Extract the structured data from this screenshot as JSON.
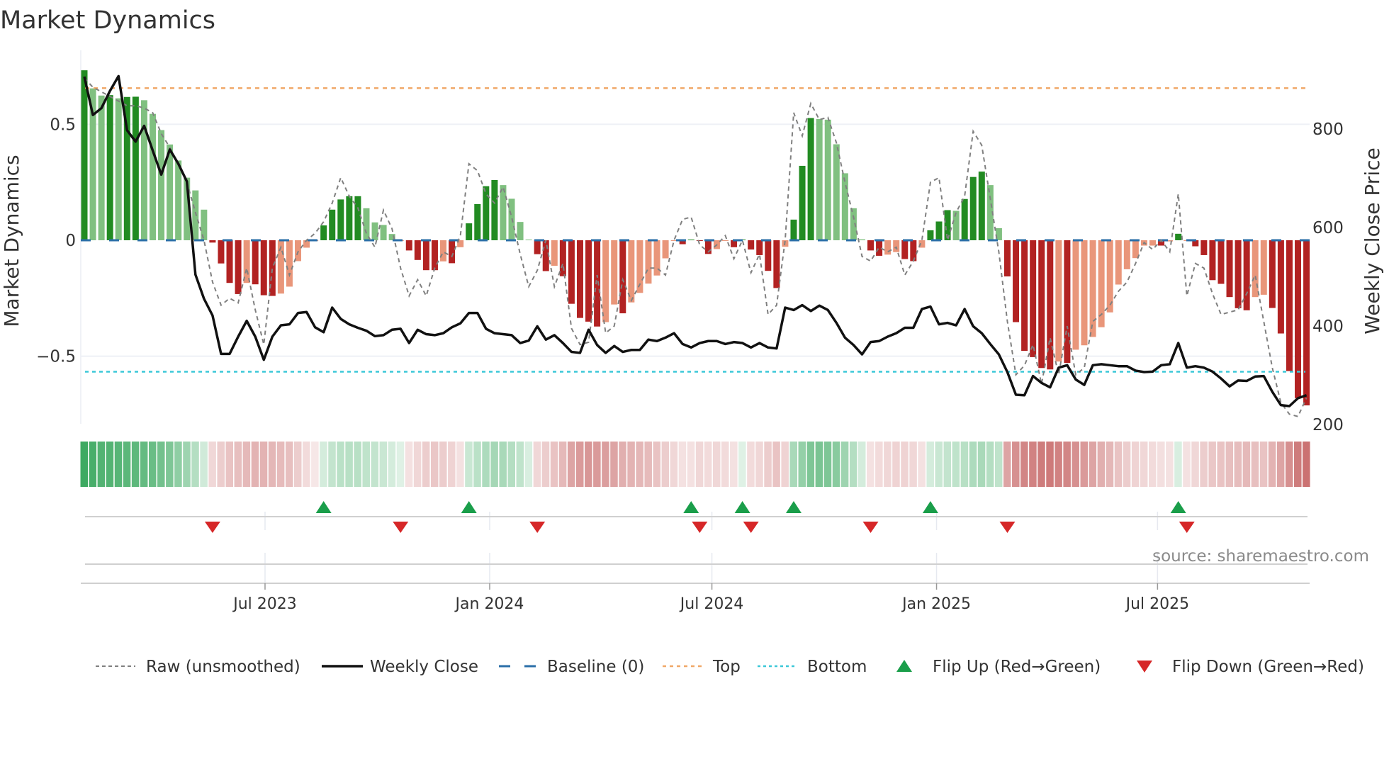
{
  "chart_data": {
    "type": "bar",
    "title": "Market Dynamics",
    "ylabel": "Market Dynamics",
    "y2label": "Weekly Close Price",
    "ylim": [
      -0.79,
      0.79
    ],
    "y2lim": [
      200,
      944
    ],
    "yticks": [
      {
        "v": 0.5,
        "label": "0.5"
      },
      {
        "v": 0,
        "label": "0"
      },
      {
        "v": -0.5,
        "label": "−0.5"
      }
    ],
    "y2ticks": [
      {
        "v": 800,
        "label": "800"
      },
      {
        "v": 600,
        "label": "600"
      },
      {
        "v": 400,
        "label": "400"
      },
      {
        "v": 200,
        "label": "200"
      }
    ],
    "start_date": "2023-02-03",
    "frequency": "weekly",
    "xticks": [
      {
        "date": "2023-07-01",
        "label": "Jul 2023"
      },
      {
        "date": "2024-01-01",
        "label": "Jan 2024"
      },
      {
        "date": "2024-07-01",
        "label": "Jul 2024"
      },
      {
        "date": "2025-01-01",
        "label": "Jan 2025"
      },
      {
        "date": "2025-07-01",
        "label": "Jul 2025"
      }
    ],
    "top": 0.656,
    "bottom": -0.567,
    "baseline": 0,
    "values": [
      0.733,
      0.655,
      0.624,
      0.626,
      0.612,
      0.618,
      0.619,
      0.604,
      0.545,
      0.475,
      0.413,
      0.344,
      0.27,
      0.215,
      0.132,
      -0.01,
      -0.1,
      -0.184,
      -0.232,
      -0.184,
      -0.19,
      -0.237,
      -0.24,
      -0.23,
      -0.2,
      -0.09,
      -0.032,
      -0.003,
      0.064,
      0.132,
      0.176,
      0.19,
      0.19,
      0.138,
      0.077,
      0.066,
      0.027,
      -0.003,
      -0.044,
      -0.085,
      -0.129,
      -0.129,
      -0.091,
      -0.099,
      -0.03,
      0.073,
      0.156,
      0.233,
      0.26,
      0.238,
      0.179,
      0.079,
      0.003,
      -0.06,
      -0.133,
      -0.11,
      -0.155,
      -0.274,
      -0.335,
      -0.351,
      -0.372,
      -0.353,
      -0.277,
      -0.315,
      -0.268,
      -0.227,
      -0.187,
      -0.152,
      -0.078,
      -0.003,
      -0.017,
      0.003,
      -0.003,
      -0.059,
      -0.038,
      -0.003,
      -0.03,
      0.003,
      -0.04,
      -0.064,
      -0.132,
      -0.206,
      -0.028,
      0.089,
      0.321,
      0.527,
      0.523,
      0.52,
      0.414,
      0.289,
      0.138,
      0.004,
      -0.044,
      -0.067,
      -0.062,
      -0.051,
      -0.081,
      -0.09,
      -0.032,
      0.043,
      0.081,
      0.13,
      0.127,
      0.178,
      0.273,
      0.296,
      0.238,
      0.052,
      -0.156,
      -0.353,
      -0.477,
      -0.504,
      -0.551,
      -0.557,
      -0.523,
      -0.529,
      -0.472,
      -0.453,
      -0.417,
      -0.375,
      -0.311,
      -0.191,
      -0.125,
      -0.077,
      -0.023,
      -0.023,
      -0.023,
      -0.005,
      0.028,
      -0.003,
      -0.026,
      -0.064,
      -0.172,
      -0.188,
      -0.245,
      -0.293,
      -0.302,
      -0.245,
      -0.235,
      -0.292,
      -0.402,
      -0.564,
      -0.681,
      -0.712
    ],
    "strong": [
      1,
      0,
      0,
      1,
      0,
      1,
      1,
      0,
      0,
      0,
      0,
      0,
      0,
      0,
      0,
      1,
      1,
      1,
      1,
      0,
      1,
      1,
      1,
      0,
      0,
      0,
      0,
      0,
      1,
      1,
      1,
      1,
      1,
      0,
      0,
      0,
      0,
      0,
      1,
      1,
      1,
      1,
      0,
      1,
      0,
      1,
      1,
      1,
      1,
      0,
      0,
      0,
      0,
      1,
      1,
      0,
      1,
      1,
      1,
      1,
      1,
      0,
      0,
      1,
      0,
      0,
      0,
      0,
      0,
      0,
      1,
      1,
      1,
      1,
      0,
      0,
      1,
      1,
      1,
      1,
      1,
      1,
      0,
      1,
      1,
      1,
      0,
      0,
      0,
      0,
      0,
      0,
      1,
      1,
      0,
      0,
      1,
      1,
      0,
      1,
      1,
      1,
      0,
      1,
      1,
      1,
      0,
      0,
      1,
      1,
      1,
      1,
      1,
      1,
      0,
      1,
      0,
      0,
      0,
      0,
      0,
      0,
      0,
      0,
      0,
      0,
      1,
      0,
      1,
      0,
      1,
      1,
      1,
      1,
      1,
      1,
      1,
      0,
      0,
      1,
      1,
      1,
      1,
      1
    ],
    "raw": [
      0.7,
      0.66,
      0.64,
      0.62,
      0.6,
      0.58,
      0.58,
      0.57,
      0.55,
      0.46,
      0.4,
      0.33,
      0.25,
      0.12,
      0.0,
      -0.18,
      -0.28,
      -0.25,
      -0.27,
      -0.12,
      -0.3,
      -0.45,
      -0.12,
      -0.03,
      -0.15,
      -0.05,
      0.0,
      0.03,
      0.08,
      0.16,
      0.27,
      0.19,
      0.14,
      0.03,
      -0.03,
      0.13,
      0.05,
      -0.12,
      -0.24,
      -0.17,
      -0.24,
      -0.12,
      -0.05,
      -0.07,
      0.02,
      0.33,
      0.3,
      0.2,
      0.16,
      0.23,
      0.1,
      -0.06,
      -0.2,
      -0.13,
      0.0,
      -0.2,
      -0.1,
      -0.38,
      -0.45,
      -0.44,
      -0.15,
      -0.4,
      -0.37,
      -0.17,
      -0.26,
      -0.19,
      -0.12,
      -0.12,
      -0.15,
      0.0,
      0.09,
      0.1,
      -0.02,
      -0.05,
      -0.02,
      0.02,
      -0.08,
      0.0,
      -0.14,
      -0.06,
      -0.32,
      -0.28,
      0.0,
      0.55,
      0.45,
      0.59,
      0.52,
      0.53,
      0.42,
      0.25,
      0.1,
      -0.07,
      -0.09,
      -0.03,
      -0.05,
      -0.03,
      -0.15,
      -0.09,
      0.0,
      0.25,
      0.27,
      0.0,
      0.12,
      0.19,
      0.47,
      0.41,
      0.18,
      -0.05,
      -0.35,
      -0.58,
      -0.54,
      -0.45,
      -0.62,
      -0.42,
      -0.58,
      -0.37,
      -0.58,
      -0.55,
      -0.35,
      -0.32,
      -0.28,
      -0.22,
      -0.18,
      -0.1,
      -0.01,
      -0.04,
      0.0,
      -0.05,
      0.2,
      -0.24,
      -0.1,
      -0.12,
      -0.23,
      -0.32,
      -0.31,
      -0.3,
      -0.23,
      -0.15,
      -0.35,
      -0.55,
      -0.7,
      -0.75,
      -0.76,
      -0.68
    ],
    "close": [
      905,
      827,
      841,
      876,
      906,
      796,
      773,
      805,
      755,
      706,
      757,
      728,
      692,
      503,
      454,
      420,
      342,
      342,
      377,
      409,
      377,
      330,
      377,
      400,
      402,
      425,
      427,
      396,
      386,
      436,
      413,
      402,
      395,
      389,
      378,
      380,
      391,
      393,
      364,
      391,
      382,
      380,
      384,
      396,
      404,
      425,
      425,
      393,
      384,
      382,
      380,
      364,
      369,
      398,
      371,
      380,
      364,
      346,
      344,
      391,
      360,
      344,
      358,
      346,
      350,
      350,
      371,
      368,
      375,
      384,
      362,
      355,
      364,
      368,
      368,
      362,
      366,
      364,
      355,
      364,
      355,
      353,
      436,
      431,
      441,
      429,
      440,
      431,
      405,
      375,
      360,
      341,
      366,
      368,
      377,
      384,
      395,
      395,
      433,
      438,
      402,
      405,
      400,
      433,
      398,
      384,
      362,
      341,
      305,
      259,
      258,
      297,
      283,
      274,
      314,
      319,
      290,
      279,
      319,
      321,
      319,
      317,
      317,
      308,
      305,
      306,
      319,
      321,
      364,
      314,
      317,
      314,
      306,
      292,
      276,
      288,
      287,
      296,
      297,
      265,
      238,
      236,
      252,
      258
    ],
    "strip": [
      0.9,
      0.85,
      0.8,
      0.8,
      0.78,
      0.76,
      0.75,
      0.72,
      0.7,
      0.65,
      0.6,
      0.52,
      0.45,
      0.35,
      0.22,
      -0.2,
      -0.25,
      -0.3,
      -0.32,
      -0.35,
      -0.38,
      -0.38,
      -0.36,
      -0.34,
      -0.32,
      -0.25,
      -0.18,
      -0.12,
      0.2,
      0.28,
      0.32,
      0.33,
      0.33,
      0.3,
      0.28,
      0.25,
      0.2,
      0.15,
      -0.15,
      -0.2,
      -0.25,
      -0.28,
      -0.25,
      -0.22,
      -0.15,
      0.25,
      0.32,
      0.38,
      0.42,
      0.4,
      0.35,
      0.3,
      0.18,
      -0.2,
      -0.25,
      -0.3,
      -0.35,
      -0.45,
      -0.5,
      -0.52,
      -0.5,
      -0.48,
      -0.45,
      -0.4,
      -0.38,
      -0.36,
      -0.34,
      -0.3,
      -0.25,
      -0.2,
      -0.15,
      -0.15,
      -0.2,
      -0.18,
      -0.2,
      -0.18,
      -0.15,
      0.15,
      -0.18,
      -0.2,
      -0.25,
      -0.3,
      -0.22,
      0.4,
      0.5,
      0.6,
      0.62,
      0.6,
      0.55,
      0.45,
      0.35,
      0.2,
      -0.15,
      -0.18,
      -0.2,
      -0.22,
      -0.22,
      -0.2,
      -0.15,
      0.2,
      0.25,
      0.28,
      0.3,
      0.33,
      0.38,
      0.4,
      0.35,
      0.3,
      -0.45,
      -0.55,
      -0.6,
      -0.62,
      -0.65,
      -0.66,
      -0.62,
      -0.6,
      -0.55,
      -0.5,
      -0.45,
      -0.4,
      -0.36,
      -0.3,
      -0.25,
      -0.22,
      -0.2,
      -0.18,
      -0.16,
      -0.15,
      0.18,
      -0.15,
      -0.2,
      -0.25,
      -0.28,
      -0.3,
      -0.32,
      -0.33,
      -0.35,
      -0.32,
      -0.3,
      -0.38,
      -0.45,
      -0.55,
      -0.65,
      -0.7
    ],
    "flip_up_weeks": [
      28,
      45,
      71,
      77,
      83,
      99,
      128
    ],
    "flip_down_weeks": [
      15,
      37,
      53,
      72,
      78,
      92,
      108,
      129
    ],
    "legend": [
      {
        "key": "raw",
        "label": "Raw (unsmoothed)"
      },
      {
        "key": "close",
        "label": "Weekly Close"
      },
      {
        "key": "baseline",
        "label": "Baseline (0)"
      },
      {
        "key": "top",
        "label": "Top"
      },
      {
        "key": "bottom",
        "label": "Bottom"
      },
      {
        "key": "flip_up",
        "label": "Flip Up (Red→Green)"
      },
      {
        "key": "flip_down",
        "label": "Flip Down (Green→Red)"
      }
    ],
    "legend_position": "bottom",
    "source": "source: sharemaestro.com",
    "colors": {
      "strong_green": "#228b22",
      "weak_green": "#80c080",
      "strong_red": "#b22222",
      "weak_red": "#e9967a",
      "close": "#111111",
      "raw": "#808080",
      "baseline": "#2b6fa8",
      "top": "#f0a868",
      "bottom": "#3cc8d8",
      "flip_up": "#1a9e4a",
      "flip_down": "#d62728"
    }
  }
}
